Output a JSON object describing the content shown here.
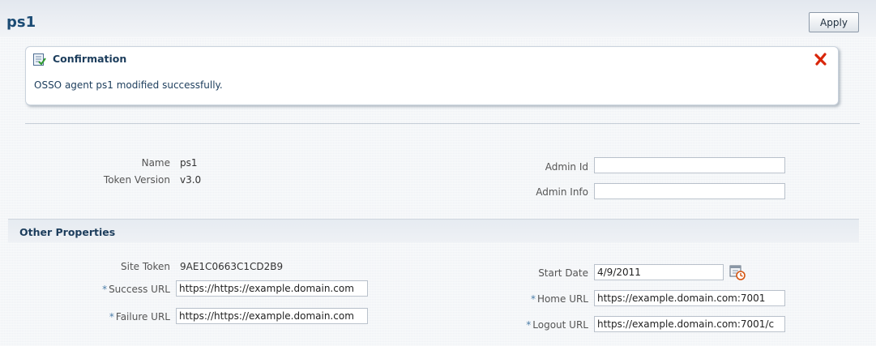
{
  "header": {
    "title": "ps1",
    "apply_label": "Apply"
  },
  "confirmation": {
    "title": "Confirmation",
    "message": "OSSO agent ps1 modified successfully.",
    "icons": {
      "status": "checklist-icon",
      "close": "close-x-icon"
    },
    "close_color": "#d9260a"
  },
  "general": {
    "name_label": "Name",
    "name_value": "ps1",
    "token_version_label": "Token Version",
    "token_version_value": "v3.0",
    "admin_id_label": "Admin Id",
    "admin_id_value": "",
    "admin_info_label": "Admin Info",
    "admin_info_value": ""
  },
  "other_properties": {
    "section_title": "Other Properties",
    "required_marker": "*",
    "site_token_label": "Site Token",
    "site_token_value": "9AE1C0663C1CD2B9",
    "success_url_label": "Success URL",
    "success_url_value": "https://https://example.domain.com",
    "failure_url_label": "Failure URL",
    "failure_url_value": "https://https://example.domain.com",
    "start_date_label": "Start Date",
    "start_date_value": "4/9/2011",
    "home_url_label": "Home URL",
    "home_url_value": "https://example.domain.com:7001",
    "logout_url_label": "Logout URL",
    "logout_url_value": "https://example.domain.com:7001/c",
    "calendar_icon": "calendar-icon"
  },
  "colors": {
    "title": "#1b4b74",
    "required": "#4b7da8"
  }
}
